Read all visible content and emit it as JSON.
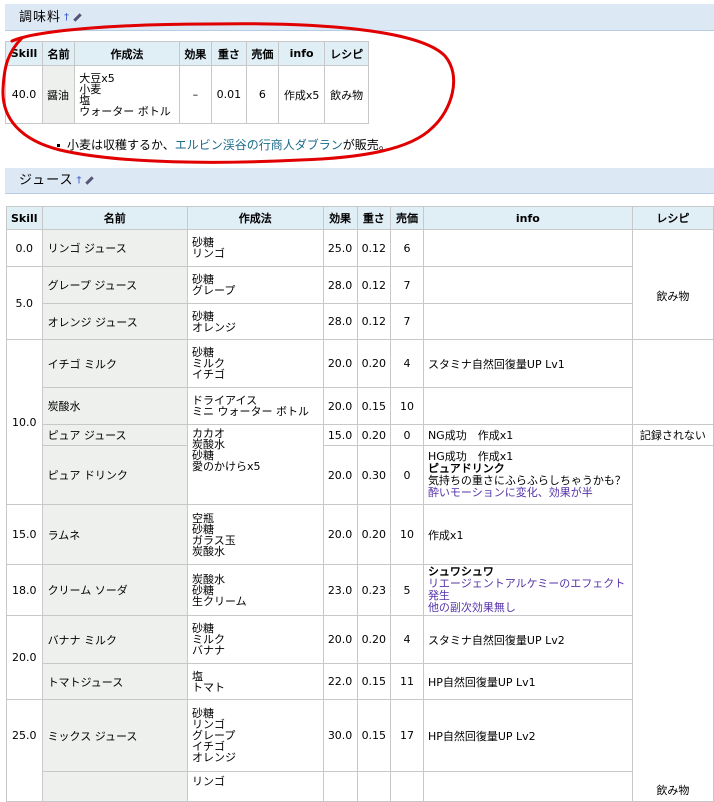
{
  "section1": {
    "title": "調味料",
    "anchor": "†",
    "headers": [
      "Skill",
      "名前",
      "作成法",
      "効果",
      "重さ",
      "売価",
      "info",
      "レシピ"
    ],
    "row": {
      "skill": "40.0",
      "name": "醤油",
      "materials": [
        "大豆x5",
        "小麦",
        "塩",
        "ウォーター ボトル"
      ],
      "effect": "–",
      "weight": "0.01",
      "price": "6",
      "info": "作成x5",
      "recipe": "飲み物"
    },
    "note": {
      "before": "小麦は収穫するか、",
      "link": "エルビン渓谷の行商人ダブラン",
      "after": "が販売。"
    }
  },
  "section2": {
    "title": "ジュース",
    "anchor": "†",
    "headers": [
      "Skill",
      "名前",
      "作成法",
      "効果",
      "重さ",
      "売価",
      "info",
      "レシピ"
    ],
    "skills": [
      "0.0",
      "5.0",
      "10.0",
      "15.0",
      "18.0",
      "20.0",
      "25.0"
    ],
    "rows": [
      {
        "name": "リンゴ ジュース",
        "materials": [
          "砂糖",
          "リンゴ"
        ],
        "effect": "25.0",
        "weight": "0.12",
        "price": "6"
      },
      {
        "name": "グレープ ジュース",
        "materials": [
          "砂糖",
          "グレープ"
        ],
        "effect": "28.0",
        "weight": "0.12",
        "price": "7"
      },
      {
        "name": "オレンジ ジュース",
        "materials": [
          "砂糖",
          "オレンジ"
        ],
        "effect": "28.0",
        "weight": "0.12",
        "price": "7"
      },
      {
        "name": "イチゴ ミルク",
        "materials": [
          "砂糖",
          "ミルク",
          "イチゴ"
        ],
        "effect": "20.0",
        "weight": "0.20",
        "price": "4",
        "info": "スタミナ自然回復量UP Lv1"
      },
      {
        "name": "炭酸水",
        "materials": [
          "ドライアイス",
          "ミニ ウォーター ボトル"
        ],
        "effect": "20.0",
        "weight": "0.15",
        "price": "10"
      },
      {
        "name": "ピュア ジュース",
        "effect": "15.0",
        "weight": "0.20",
        "price": "0",
        "info": "NG成功　作成x1"
      },
      {
        "name": "ピュア ドリンク",
        "effect": "20.0",
        "weight": "0.30",
        "price": "0",
        "info1": "HG成功　作成x1",
        "info2": "ピュアドリンク",
        "info3": "気持ちの重さにふらふらしちゃうかも？",
        "info4": "酔いモーションに変化、効果が半"
      },
      {
        "name": "ラムネ",
        "materials": [
          "空瓶",
          "砂糖",
          "ガラス玉",
          "炭酸水"
        ],
        "effect": "20.0",
        "weight": "0.20",
        "price": "10",
        "info": "作成x1"
      },
      {
        "name": "クリーム ソーダ",
        "materials": [
          "炭酸水",
          "砂糖",
          "生クリーム"
        ],
        "effect": "23.0",
        "weight": "0.23",
        "price": "5",
        "info1": "シュワシュワ",
        "info2": "リエージェントアルケミーのエフェクト発生",
        "info3": "他の副次効果無し"
      },
      {
        "name": "バナナ ミルク",
        "materials": [
          "砂糖",
          "ミルク",
          "バナナ"
        ],
        "effect": "20.0",
        "weight": "0.20",
        "price": "4",
        "info": "スタミナ自然回復量UP Lv2"
      },
      {
        "name": "トマトジュース",
        "materials": [
          "塩",
          "トマト"
        ],
        "effect": "22.0",
        "weight": "0.15",
        "price": "11",
        "info": "HP自然回復量UP Lv1"
      },
      {
        "name": "ミックス ジュース",
        "materials": [
          "砂糖",
          "リンゴ",
          "グレープ",
          "イチゴ",
          "オレンジ"
        ],
        "effect": "30.0",
        "weight": "0.15",
        "price": "17",
        "info": "HP自然回復量UP Lv2"
      },
      {
        "materials": [
          "リンゴ"
        ]
      }
    ],
    "pure_materials": [
      "カカオ",
      "炭酸水",
      "砂糖",
      "愛のかけらx5"
    ],
    "recipe_drink": "飲み物",
    "recipe_not_recorded": "記録されない",
    "recipe_drink_bottom": "飲み物"
  },
  "annotation_color": "#e00000"
}
